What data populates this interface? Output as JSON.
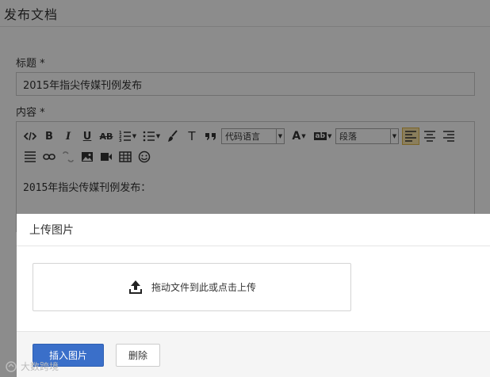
{
  "page": {
    "title": "发布文档",
    "title_label": "标题 *",
    "title_value": "2015年指尖传媒刊例发布",
    "content_label": "内容 *",
    "editor_text": "2015年指尖传媒刊例发布："
  },
  "toolbar": {
    "code_lang": "代码语言",
    "paragraph": "段落",
    "text_icon_t": "T",
    "text_icon_b": "B",
    "text_icon_i": "I",
    "text_icon_u": "U",
    "text_icon_ab": "AB",
    "font_color": "A",
    "bg_color": "ab"
  },
  "dialog": {
    "title": "上传图片",
    "upload_hint": "拖动文件到此或点击上传",
    "insert_label": "插入图片",
    "delete_label": "删除"
  },
  "watermark": {
    "text": "大数跨境"
  },
  "colors": {
    "primary": "#3a6fc9",
    "overlay": "rgba(0,0,0,0.45)",
    "active_align": "#fbe6a8"
  }
}
